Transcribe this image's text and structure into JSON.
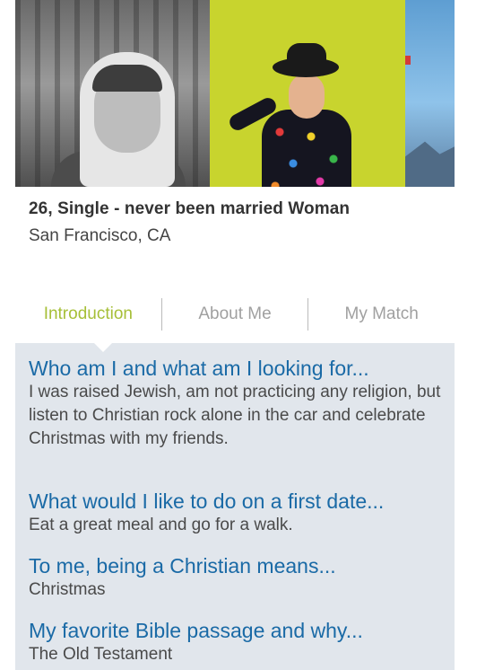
{
  "profile": {
    "headline": "26, Single - never been married Woman",
    "location": "San Francisco, CA",
    "photos": [
      "photo-1",
      "photo-2",
      "photo-3"
    ]
  },
  "tabs": [
    {
      "label": "Introduction",
      "active": true
    },
    {
      "label": "About Me",
      "active": false
    },
    {
      "label": "My Match",
      "active": false
    }
  ],
  "colors": {
    "active_tab": "#a6bf37",
    "question": "#1a6aa6",
    "panel_bg": "#e1e6ec"
  },
  "intro": [
    {
      "question": "Who am I and what am I looking for...",
      "answer": "I was raised Jewish, am not practicing any religion, but listen to Christian rock alone in the car and celebrate Christmas with my friends."
    },
    {
      "question": "What would I like to do on a first date...",
      "answer": "Eat a great meal and go for a walk."
    },
    {
      "question": "To me, being a Christian means...",
      "answer": "Christmas"
    },
    {
      "question": "My favorite Bible passage and why...",
      "answer": "The Old Testament"
    }
  ]
}
